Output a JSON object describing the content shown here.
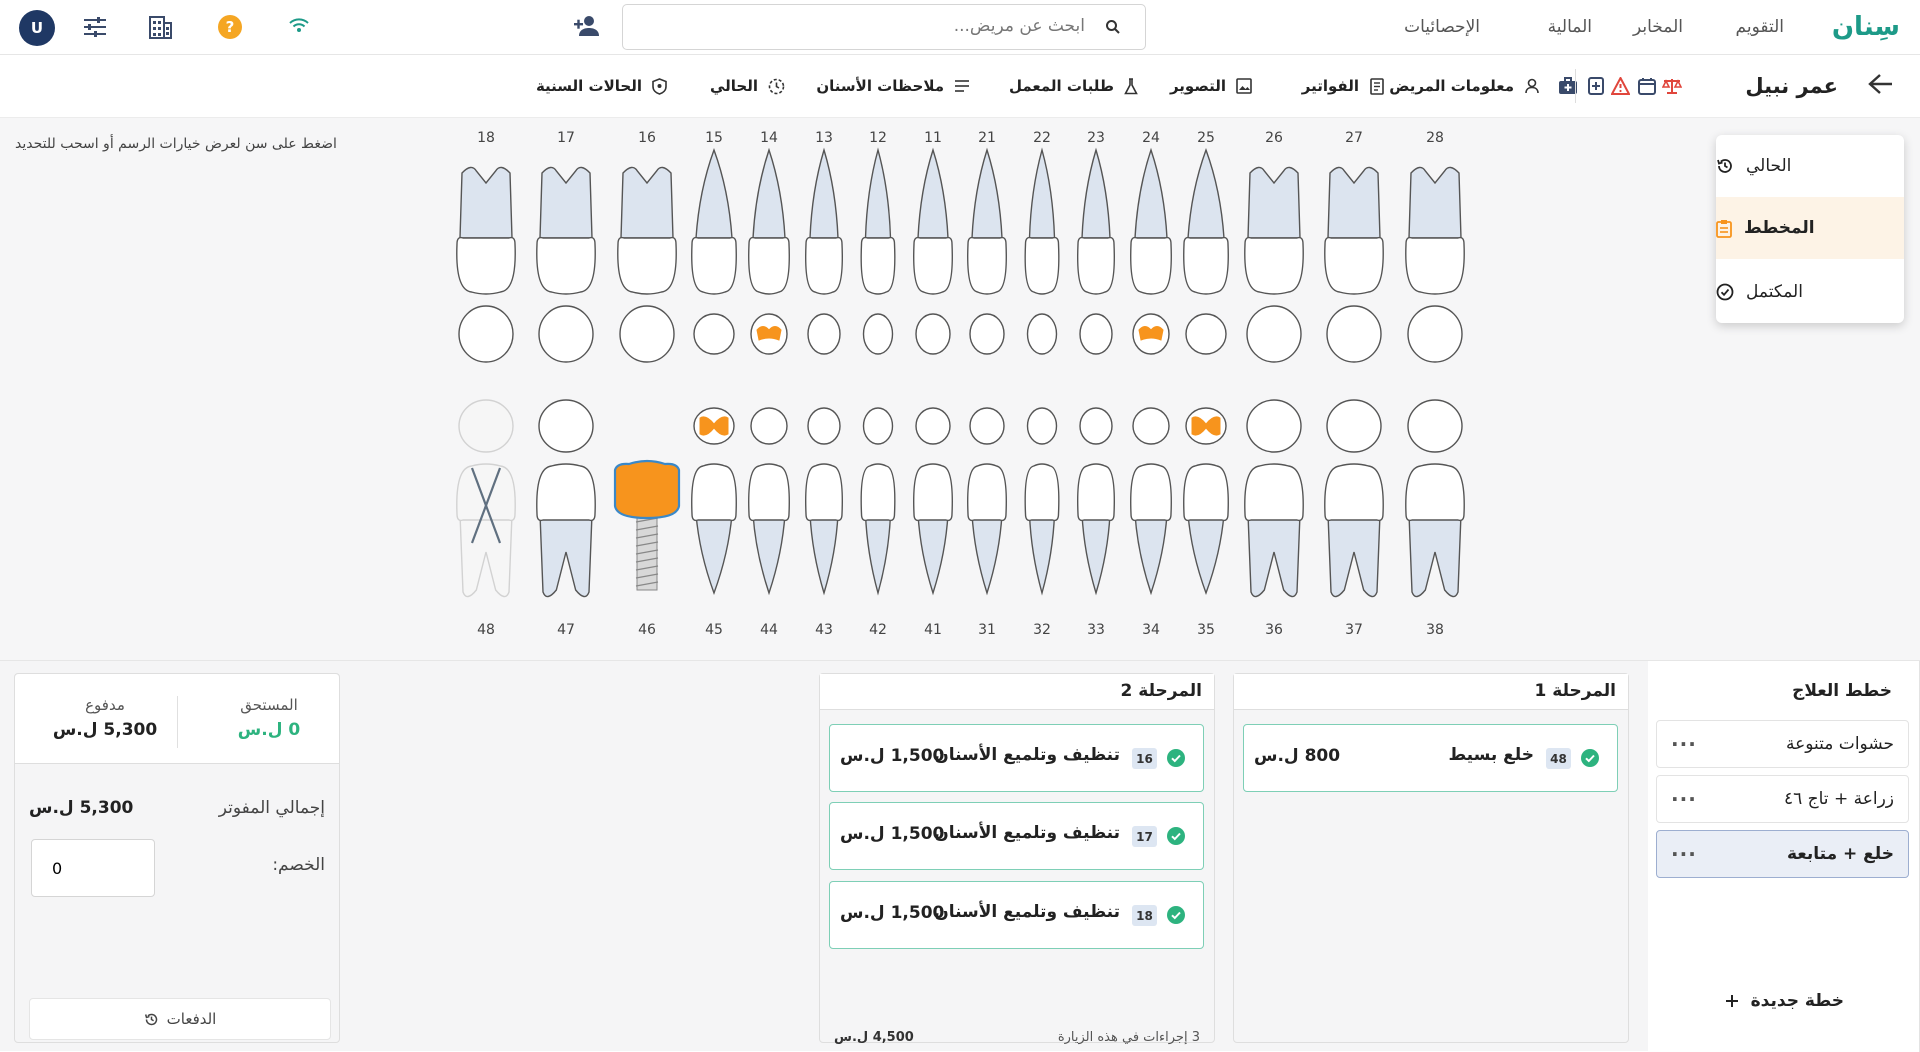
{
  "app": {
    "brand": "سِنان"
  },
  "topnav": {
    "items": [
      "التقويم",
      "المخابر",
      "المالية",
      "الإحصائيات"
    ]
  },
  "search": {
    "placeholder": "ابحث عن مريض..."
  },
  "user": {
    "initial": "U",
    "help": "?"
  },
  "patient": {
    "name": "عمر نبيل",
    "tabs": [
      "معلومات المريض",
      "الفواتير",
      "التصوير",
      "طلبات المعمل",
      "ملاحظات الأسنان",
      "الحالي",
      "الحالات السنية"
    ]
  },
  "chart": {
    "hint": "اضغط على سن لعرض خيارات الرسم أو اسحب للتحديد",
    "upper_numbers": [
      "18",
      "17",
      "16",
      "15",
      "14",
      "13",
      "12",
      "11",
      "21",
      "22",
      "23",
      "24",
      "25",
      "26",
      "27",
      "28"
    ],
    "lower_numbers": [
      "48",
      "47",
      "46",
      "45",
      "44",
      "43",
      "42",
      "41",
      "31",
      "32",
      "33",
      "34",
      "35",
      "36",
      "37",
      "38"
    ],
    "highlight_color": "#f7941d",
    "implant_tooth": "46",
    "missing_tooth": "48",
    "filled_teeth": [
      "14",
      "24",
      "45",
      "35"
    ]
  },
  "viewmenu": {
    "items": [
      "الحالي",
      "المخطط",
      "المكتمل"
    ],
    "active": "المخطط"
  },
  "plans": {
    "title": "خطط العلاج",
    "items": [
      "حشوات متنوعة",
      "زراعة + تاج ٤٦",
      "خلع + متابعة"
    ],
    "active": "خلع + متابعة",
    "new_label": "خطة جديدة"
  },
  "stage1": {
    "title": "المرحلة 1",
    "procedures": [
      {
        "tooth": "48",
        "name": "خلع بسيط",
        "price": "800 ل.س"
      }
    ]
  },
  "stage2": {
    "title": "المرحلة 2",
    "procedures": [
      {
        "tooth": "16",
        "name": "تنظيف وتلميع الأسنان",
        "price": "1,500 ل.س"
      },
      {
        "tooth": "17",
        "name": "تنظيف وتلميع الأسنان",
        "price": "1,500 ل.س"
      },
      {
        "tooth": "18",
        "name": "تنظيف وتلميع الأسنان",
        "price": "1,500 ل.س"
      }
    ],
    "footer_count": "3 إجراءات في هذه الزيارة",
    "footer_total": "4,500 ل.س"
  },
  "payment": {
    "paid_label": "مدفوع",
    "paid_value": "5,300 ل.س",
    "due_label": "المستحق",
    "due_value": "0 ل.س",
    "billed_label": "إجمالي المفوتر",
    "billed_value": "5,300 ل.س",
    "discount_label": "الخصم:",
    "discount_value": "0",
    "payments_button": "الدفعات"
  },
  "colors": {
    "brand": "#1d9a88",
    "accent": "#f7941d",
    "success": "#2db37f",
    "navy": "#1f3864"
  }
}
